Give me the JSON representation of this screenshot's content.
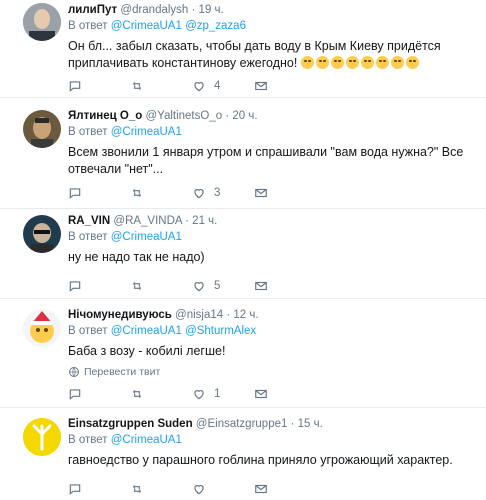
{
  "reply_prefix": "В ответ",
  "translate_label": "Перевести твит",
  "tweets": [
    {
      "name": "лилиПут",
      "handle": "@drandalysh",
      "time": "· 19 ч.",
      "mentions": [
        "@CrimeaUA1",
        "@zp_zaza6"
      ],
      "text": "Он бл... забыл сказать, чтобы дать воду в Крым Киеву придётся приплачивать константинову ежегодно!",
      "emoji_count": 8,
      "replies": "",
      "retweets": "",
      "likes": "4"
    },
    {
      "name": "Ялтинец О_о",
      "handle": "@YaltinetsO_o",
      "time": "· 20 ч.",
      "mentions": [
        "@CrimeaUA1"
      ],
      "text": "Всем звонили 1 января утром и спрашивали \"вам вода нужна?\" Все отвечали \"нет\"...",
      "replies": "",
      "retweets": "",
      "likes": "3"
    },
    {
      "name": "RA_VIN",
      "handle": "@RA_VINDA",
      "time": "· 21 ч.",
      "mentions": [
        "@CrimeaUA1"
      ],
      "text": "ну не надо так не надо)",
      "replies": "",
      "retweets": "",
      "likes": "5"
    },
    {
      "name": "Нічомунедивуюсь",
      "handle": "@nisja14",
      "time": "· 12 ч.",
      "mentions": [
        "@CrimeaUA1",
        "@ShturmAlex"
      ],
      "text": "Баба з возу - кобилі легше!",
      "replies": "",
      "retweets": "",
      "likes": "1"
    },
    {
      "name": "Einsatzgruppen Suden",
      "handle": "@Einsatzgruppe1",
      "time": "· 15 ч.",
      "mentions": [
        "@CrimeaUA1"
      ],
      "text": "гавноедство у парашного гоблина приняло угрожающий характер.",
      "replies": "",
      "retweets": "",
      "likes": ""
    }
  ],
  "colors": {
    "accent": "#1da1f2",
    "muted": "#657786",
    "text": "#14171a",
    "divider": "#e6ecf0"
  }
}
